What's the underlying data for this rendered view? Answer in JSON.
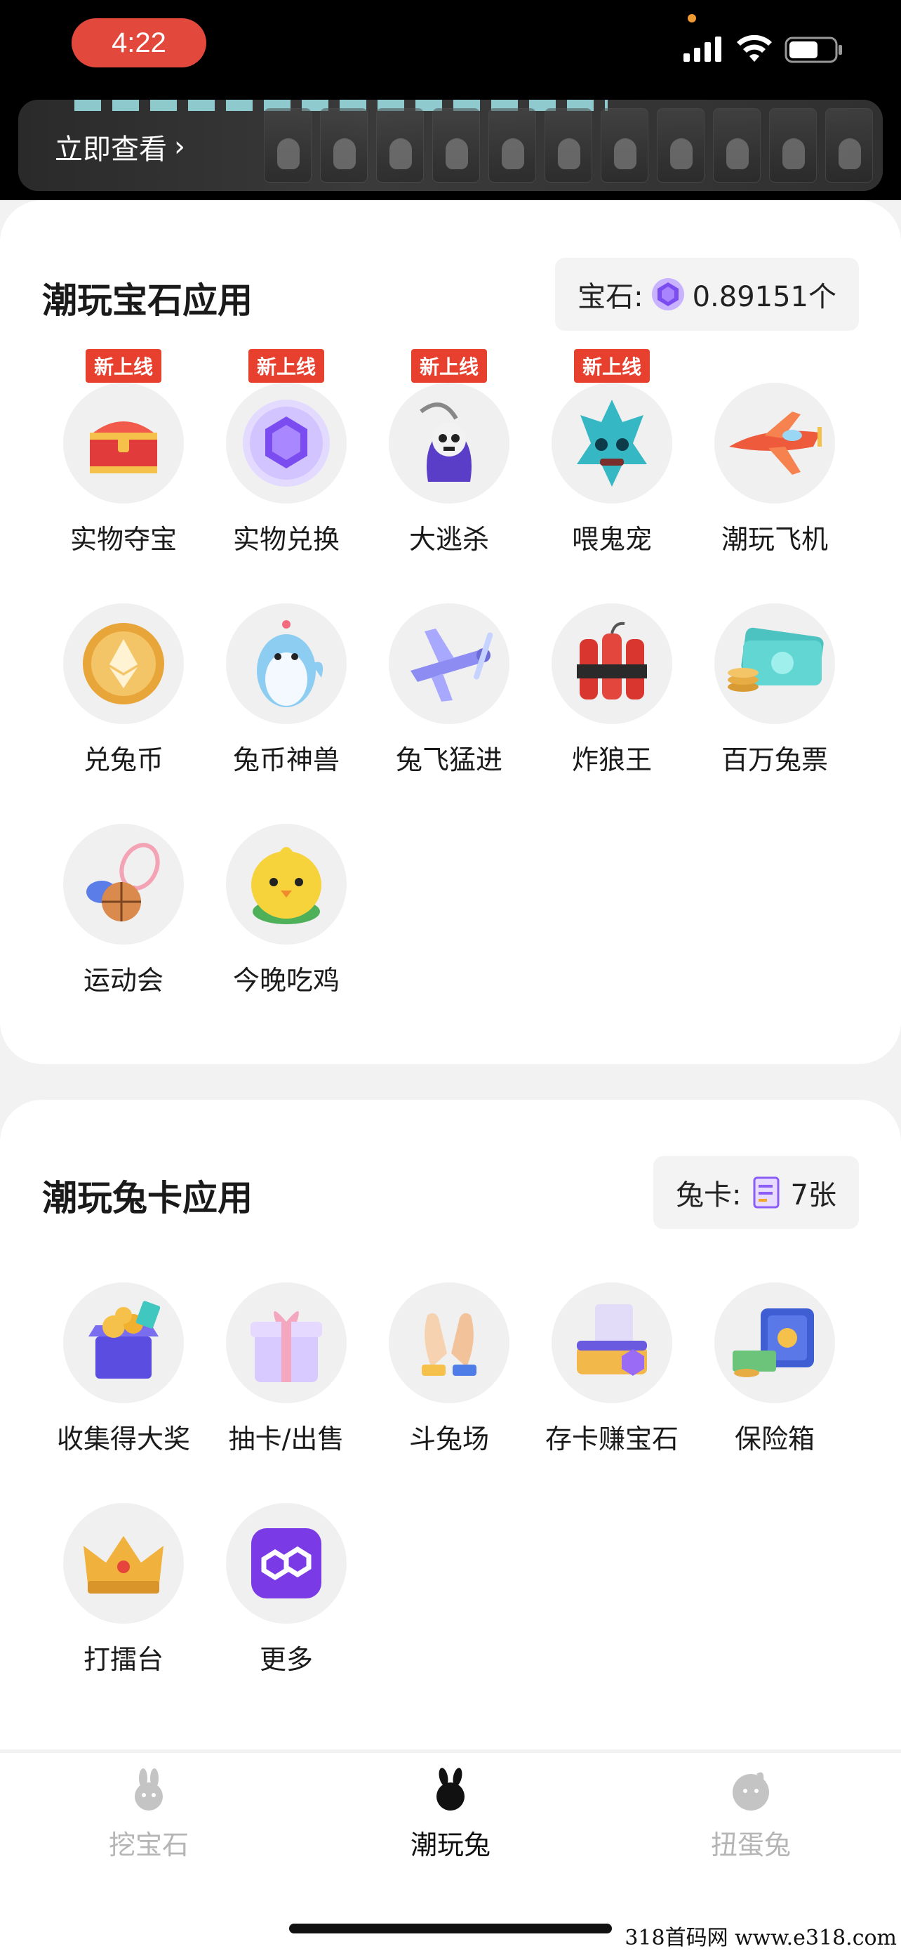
{
  "status_bar": {
    "time": "4:22"
  },
  "banner": {
    "link_label": "立即查看",
    "chevron": "›"
  },
  "gem_section": {
    "title": "潮玩宝石应用",
    "balance_label": "宝石:",
    "balance_value": "0.89151个",
    "apps": [
      {
        "label": "实物夺宝",
        "badge": "新上线",
        "icon": "treasure-chest-icon"
      },
      {
        "label": "实物兑换",
        "badge": "新上线",
        "icon": "gem-orb-icon"
      },
      {
        "label": "大逃杀",
        "badge": "新上线",
        "icon": "reaper-icon"
      },
      {
        "label": "喂鬼宠",
        "badge": "新上线",
        "icon": "ghost-pet-icon"
      },
      {
        "label": "潮玩飞机",
        "badge": "",
        "icon": "airplane-icon"
      },
      {
        "label": "兑兔币",
        "badge": "",
        "icon": "coin-icon"
      },
      {
        "label": "兔币神兽",
        "badge": "",
        "icon": "penguin-icon"
      },
      {
        "label": "兔飞猛进",
        "badge": "",
        "icon": "propeller-plane-icon"
      },
      {
        "label": "炸狼王",
        "badge": "",
        "icon": "dynamite-icon"
      },
      {
        "label": "百万兔票",
        "badge": "",
        "icon": "cash-icon"
      },
      {
        "label": "运动会",
        "badge": "",
        "icon": "sports-balls-icon"
      },
      {
        "label": "今晚吃鸡",
        "badge": "",
        "icon": "chick-icon"
      }
    ]
  },
  "card_section": {
    "title": "潮玩兔卡应用",
    "balance_label": "兔卡:",
    "balance_value": "7张",
    "apps": [
      {
        "label": "收集得大奖",
        "icon": "prize-box-icon"
      },
      {
        "label": "抽卡/出售",
        "icon": "gift-box-icon"
      },
      {
        "label": "斗兔场",
        "icon": "clapping-hands-icon"
      },
      {
        "label": "存卡赚宝石",
        "icon": "card-deposit-icon"
      },
      {
        "label": "保险箱",
        "icon": "safe-icon"
      },
      {
        "label": "打擂台",
        "icon": "crown-icon"
      },
      {
        "label": "更多",
        "icon": "more-icon"
      }
    ]
  },
  "tabbar": {
    "tabs": [
      {
        "label": "挖宝石",
        "active": false
      },
      {
        "label": "潮玩兔",
        "active": true
      },
      {
        "label": "扭蛋兔",
        "active": false
      }
    ]
  },
  "watermark": "318首码网  www.e318.com",
  "colors": {
    "badge_red": "#e8402f",
    "time_pill": "#e2493c",
    "gem_purple": "#8b5cf6"
  }
}
